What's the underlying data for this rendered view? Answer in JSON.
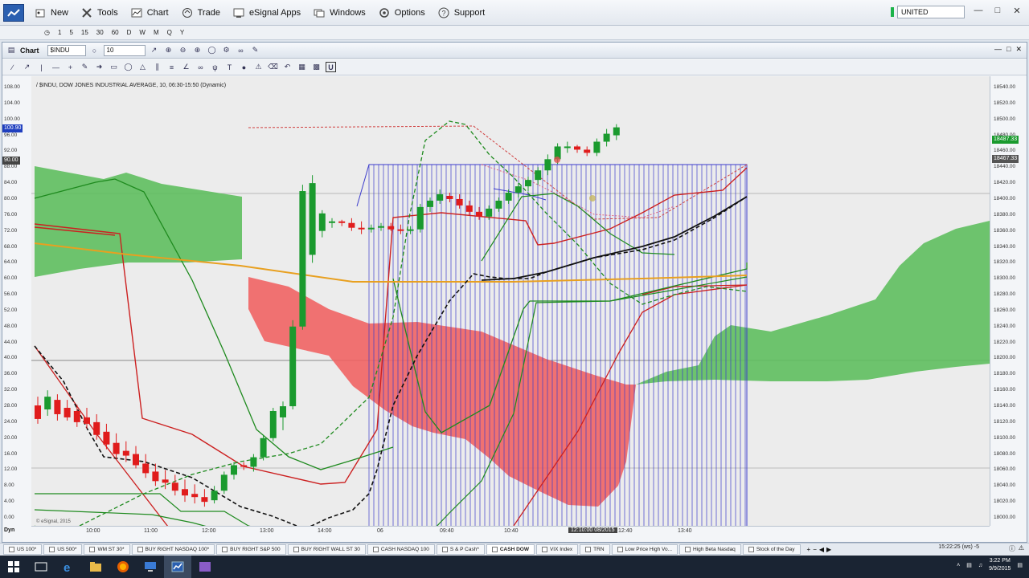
{
  "menubar": {
    "items": [
      {
        "label": "New",
        "icon": "new-document-icon"
      },
      {
        "label": "Tools",
        "icon": "tools-icon"
      },
      {
        "label": "Chart",
        "icon": "chart-icon"
      },
      {
        "label": "Trade",
        "icon": "trade-icon"
      },
      {
        "label": "eSignal Apps",
        "icon": "apps-icon"
      },
      {
        "label": "Windows",
        "icon": "windows-icon"
      },
      {
        "label": "Options",
        "icon": "options-gear-icon"
      },
      {
        "label": "Support",
        "icon": "support-help-icon"
      }
    ],
    "symbol_field": "UNITED"
  },
  "intervals": [
    "1",
    "5",
    "15",
    "30",
    "60",
    "D",
    "W",
    "M",
    "Q",
    "Y"
  ],
  "chart_window": {
    "title": "Chart",
    "symbol": "$INDU",
    "interval": "10",
    "study_label": "/ $INDU, DOW JONES INDUSTRIAL AVERAGE, 10, 06:30-15:50 (Dynamic)",
    "corner_label": "Dyn"
  },
  "left_axis_ticks": [
    "108.00",
    "104.00",
    "100.00",
    "96.00",
    "92.00",
    "88.00",
    "84.00",
    "80.00",
    "76.00",
    "72.00",
    "68.00",
    "64.00",
    "60.00",
    "56.00",
    "52.00",
    "48.00",
    "44.00",
    "40.00",
    "36.00",
    "32.00",
    "28.00",
    "24.00",
    "20.00",
    "16.00",
    "12.00",
    "8.00",
    "4.00",
    "0.00"
  ],
  "left_axis_flags": [
    {
      "label": "100.90",
      "color": "#1f3fbf"
    },
    {
      "label": "90.00",
      "color": "#444444"
    }
  ],
  "right_axis_ticks": [
    "18540.00",
    "18520.00",
    "18500.00",
    "18480.00",
    "18460.00",
    "18440.00",
    "18420.00",
    "18400.00",
    "18380.00",
    "18360.00",
    "18340.00",
    "18320.00",
    "18300.00",
    "18280.00",
    "18260.00",
    "18240.00",
    "18220.00",
    "18200.00",
    "18180.00",
    "18160.00",
    "18140.00",
    "18120.00",
    "18100.00",
    "18080.00",
    "18060.00",
    "18040.00",
    "18020.00",
    "18000.00"
  ],
  "right_axis_flags": [
    {
      "label": "18487.33",
      "color": "#1a9a2e"
    },
    {
      "label": "18467.33",
      "color": "#555555"
    }
  ],
  "time_axis": {
    "ticks": [
      "10:00",
      "11:00",
      "12:00",
      "13:00",
      "14:00",
      "06",
      "09:40",
      "10:40",
      "12:40",
      "13:40"
    ],
    "cursor_label": "12:10:00 08/2015"
  },
  "watermark": "© eSignal, 2015",
  "page_tabs": [
    {
      "label": "US 100*",
      "active": false
    },
    {
      "label": "US 500*",
      "active": false
    },
    {
      "label": "WM ST 30*",
      "active": false
    },
    {
      "label": "BUY RIGHT NASDAQ 100*",
      "active": false
    },
    {
      "label": "BUY RIGHT S&P 500",
      "active": false
    },
    {
      "label": "BUY RIGHT WALL ST 30",
      "active": false
    },
    {
      "label": "CASH NASDAQ 100",
      "active": false
    },
    {
      "label": "S & P Cash*",
      "active": false
    },
    {
      "label": "CASH DOW",
      "active": true
    },
    {
      "label": "VIX Index",
      "active": false
    },
    {
      "label": "TRN",
      "active": false
    },
    {
      "label": "Low Price High Vo...",
      "active": false
    },
    {
      "label": "High Beta Nasdaq",
      "active": false
    },
    {
      "label": "Stock of the Day",
      "active": false
    }
  ],
  "status_clock": "15:22:25 (ws) -5",
  "taskbar": {
    "time": "3:22 PM",
    "date": "9/9/2015"
  },
  "chart_data": {
    "type": "candlestick",
    "title": "",
    "ylim_left": [
      0,
      108
    ],
    "ylim_right": [
      18000,
      18540
    ],
    "candles": [
      {
        "o": 18141,
        "h": 18152,
        "l": 18118,
        "c": 18124
      },
      {
        "o": 18136,
        "h": 18160,
        "l": 18128,
        "c": 18152
      },
      {
        "o": 18148,
        "h": 18155,
        "l": 18122,
        "c": 18130
      },
      {
        "o": 18138,
        "h": 18148,
        "l": 18122,
        "c": 18126
      },
      {
        "o": 18134,
        "h": 18142,
        "l": 18114,
        "c": 18120
      },
      {
        "o": 18126,
        "h": 18138,
        "l": 18112,
        "c": 18118
      },
      {
        "o": 18120,
        "h": 18130,
        "l": 18098,
        "c": 18104
      },
      {
        "o": 18108,
        "h": 18118,
        "l": 18086,
        "c": 18092
      },
      {
        "o": 18094,
        "h": 18106,
        "l": 18074,
        "c": 18080
      },
      {
        "o": 18084,
        "h": 18096,
        "l": 18070,
        "c": 18078
      },
      {
        "o": 18080,
        "h": 18090,
        "l": 18062,
        "c": 18066
      },
      {
        "o": 18068,
        "h": 18080,
        "l": 18050,
        "c": 18056
      },
      {
        "o": 18058,
        "h": 18068,
        "l": 18040,
        "c": 18046
      },
      {
        "o": 18048,
        "h": 18060,
        "l": 18036,
        "c": 18044
      },
      {
        "o": 18044,
        "h": 18054,
        "l": 18028,
        "c": 18034
      },
      {
        "o": 18036,
        "h": 18048,
        "l": 18020,
        "c": 18028
      },
      {
        "o": 18030,
        "h": 18042,
        "l": 18018,
        "c": 18026
      },
      {
        "o": 18026,
        "h": 18036,
        "l": 18014,
        "c": 18020
      },
      {
        "o": 18022,
        "h": 18040,
        "l": 18018,
        "c": 18034
      },
      {
        "o": 18034,
        "h": 18058,
        "l": 18030,
        "c": 18054
      },
      {
        "o": 18054,
        "h": 18070,
        "l": 18048,
        "c": 18066
      },
      {
        "o": 18066,
        "h": 18070,
        "l": 18060,
        "c": 18064
      },
      {
        "o": 18064,
        "h": 18080,
        "l": 18058,
        "c": 18076
      },
      {
        "o": 18076,
        "h": 18104,
        "l": 18072,
        "c": 18100
      },
      {
        "o": 18100,
        "h": 18138,
        "l": 18096,
        "c": 18134
      },
      {
        "o": 18126,
        "h": 18146,
        "l": 18110,
        "c": 18140
      },
      {
        "o": 18140,
        "h": 18248,
        "l": 18136,
        "c": 18240
      },
      {
        "o": 18240,
        "h": 18418,
        "l": 18236,
        "c": 18410
      },
      {
        "o": 18330,
        "h": 18430,
        "l": 18320,
        "c": 18420
      },
      {
        "o": 18360,
        "h": 18386,
        "l": 18352,
        "c": 18382
      },
      {
        "o": 18370,
        "h": 18376,
        "l": 18364,
        "c": 18372
      },
      {
        "o": 18372,
        "h": 18374,
        "l": 18366,
        "c": 18370
      },
      {
        "o": 18370,
        "h": 18376,
        "l": 18360,
        "c": 18364
      },
      {
        "o": 18364,
        "h": 18372,
        "l": 18356,
        "c": 18362
      },
      {
        "o": 18362,
        "h": 18368,
        "l": 18358,
        "c": 18364
      },
      {
        "o": 18364,
        "h": 18370,
        "l": 18360,
        "c": 18366
      },
      {
        "o": 18366,
        "h": 18370,
        "l": 18360,
        "c": 18362
      },
      {
        "o": 18362,
        "h": 18368,
        "l": 18356,
        "c": 18360
      },
      {
        "o": 18360,
        "h": 18366,
        "l": 18356,
        "c": 18362
      },
      {
        "o": 18362,
        "h": 18394,
        "l": 18358,
        "c": 18390
      },
      {
        "o": 18390,
        "h": 18402,
        "l": 18384,
        "c": 18398
      },
      {
        "o": 18398,
        "h": 18412,
        "l": 18394,
        "c": 18406
      },
      {
        "o": 18404,
        "h": 18408,
        "l": 18396,
        "c": 18400
      },
      {
        "o": 18400,
        "h": 18406,
        "l": 18388,
        "c": 18392
      },
      {
        "o": 18392,
        "h": 18398,
        "l": 18380,
        "c": 18384
      },
      {
        "o": 18384,
        "h": 18390,
        "l": 18374,
        "c": 18378
      },
      {
        "o": 18378,
        "h": 18392,
        "l": 18374,
        "c": 18388
      },
      {
        "o": 18388,
        "h": 18402,
        "l": 18384,
        "c": 18398
      },
      {
        "o": 18398,
        "h": 18412,
        "l": 18394,
        "c": 18408
      },
      {
        "o": 18408,
        "h": 18420,
        "l": 18402,
        "c": 18416
      },
      {
        "o": 18416,
        "h": 18428,
        "l": 18410,
        "c": 18424
      },
      {
        "o": 18424,
        "h": 18440,
        "l": 18418,
        "c": 18436
      },
      {
        "o": 18436,
        "h": 18456,
        "l": 18430,
        "c": 18450
      },
      {
        "o": 18450,
        "h": 18470,
        "l": 18444,
        "c": 18466
      },
      {
        "o": 18466,
        "h": 18472,
        "l": 18458,
        "c": 18466
      },
      {
        "o": 18466,
        "h": 18468,
        "l": 18458,
        "c": 18462
      },
      {
        "o": 18462,
        "h": 18466,
        "l": 18454,
        "c": 18458
      },
      {
        "o": 18458,
        "h": 18476,
        "l": 18454,
        "c": 18472
      },
      {
        "o": 18472,
        "h": 18488,
        "l": 18466,
        "c": 18482
      },
      {
        "o": 18480,
        "h": 18494,
        "l": 18474,
        "c": 18490
      }
    ],
    "colors": {
      "up": "#1a9a2e",
      "down": "#e01c1c",
      "cloud_up": "#5fbf5f",
      "cloud_down": "#f06060",
      "hist": "#3b3bcc"
    }
  }
}
